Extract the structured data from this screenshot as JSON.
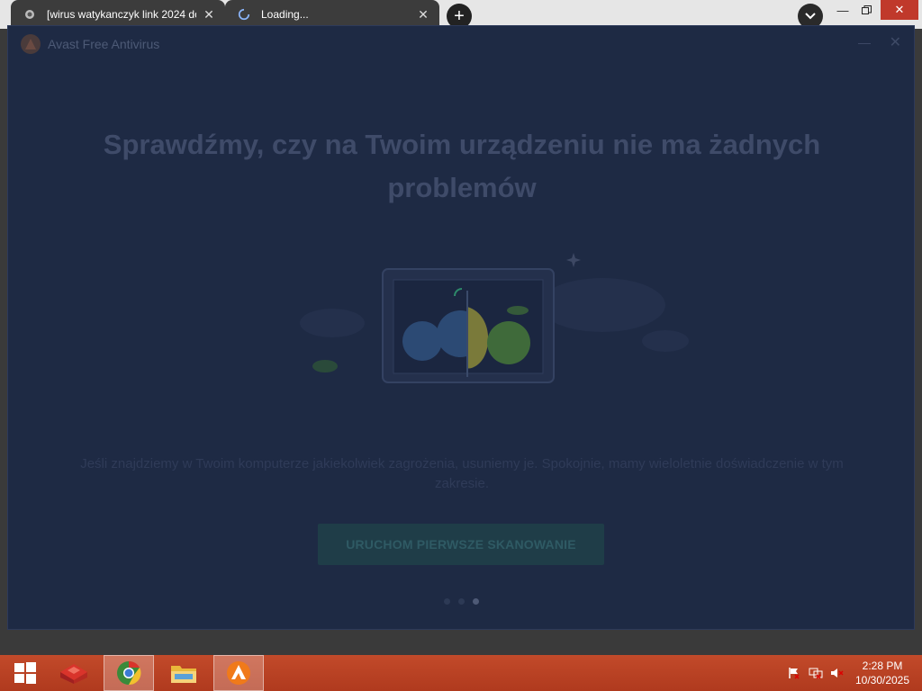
{
  "browser": {
    "tabs": [
      {
        "title": "[wirus watykanczyk link 2024 do"
      },
      {
        "title": "Loading..."
      }
    ],
    "new_tab_symbol": "+"
  },
  "avast": {
    "app_title": "Avast Free Antivirus",
    "headline": "Sprawdźmy, czy na Twoim urządzeniu nie ma żadnych problemów",
    "description": "Jeśli znajdziemy w Twoim komputerze jakiekolwiek zagrożenia, usuniemy je. Spokojnie, mamy wieloletnie doświadczenie w tym zakresie.",
    "scan_button": "URUCHOM PIERWSZE SKANOWANIE",
    "carousel_total": 3,
    "carousel_active": 3
  },
  "taskbar": {
    "items": [
      "windows-start-icon",
      "toolbox-icon",
      "chrome-browser-icon",
      "file-explorer-icon",
      "avast-icon"
    ],
    "clock_time": "2:28 PM",
    "clock_date": "10/30/2025"
  }
}
